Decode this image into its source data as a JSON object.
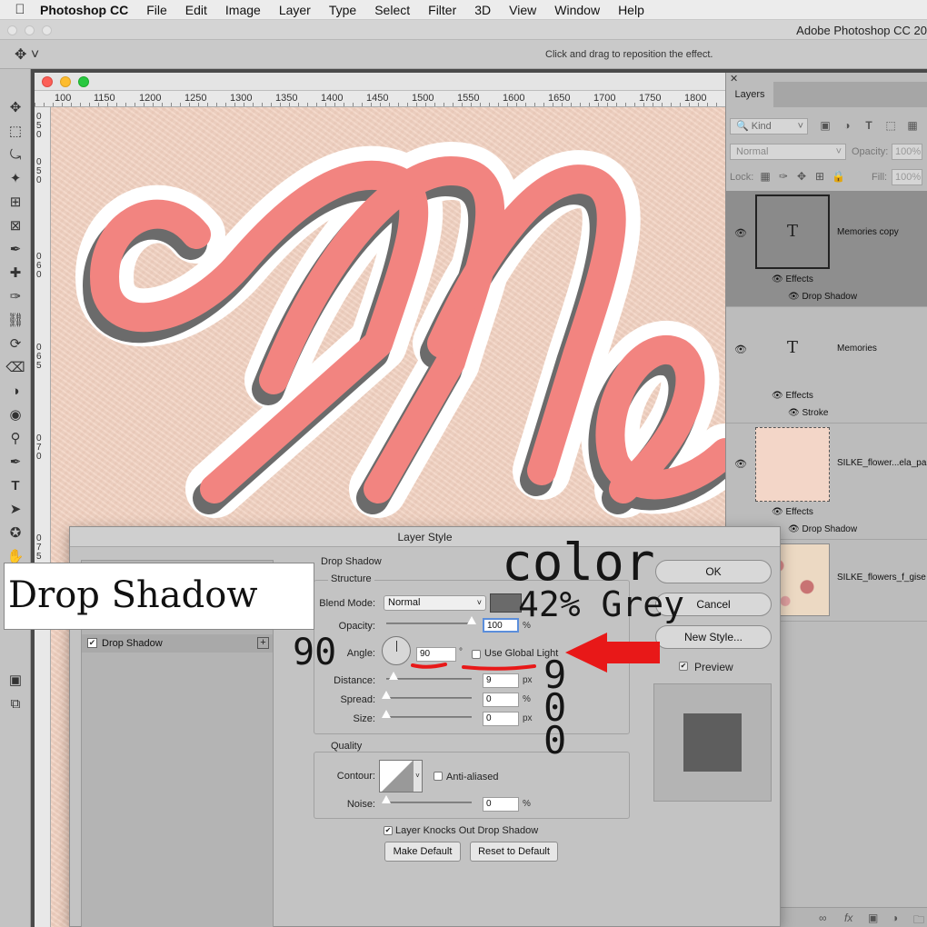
{
  "menubar": {
    "apple": "",
    "app": "Photoshop CC",
    "items": [
      "File",
      "Edit",
      "Image",
      "Layer",
      "Type",
      "Select",
      "Filter",
      "3D",
      "View",
      "Window",
      "Help"
    ]
  },
  "app_title": "Adobe Photoshop CC 20",
  "options_bar": {
    "hint": "Click and drag to reposition the effect."
  },
  "ruler": {
    "h_ticks": [
      "100",
      "1150",
      "1200",
      "1250",
      "1300",
      "1350",
      "1400",
      "1450",
      "1500",
      "1550",
      "1600",
      "1650",
      "1700",
      "1750",
      "1800"
    ],
    "v_ticks": [
      "0",
      "5",
      "0",
      "0",
      "5",
      "0",
      "0",
      "6",
      "0",
      "0",
      "6",
      "5",
      "0",
      "7",
      "0",
      "0",
      "7",
      "5",
      "0"
    ]
  },
  "artwork": {
    "letters": "Me",
    "fill_color": "#f28480",
    "shadow_color": "#6b6b6b",
    "outline_color": "#ffffff"
  },
  "layers_panel": {
    "tab": "Layers",
    "filter_kind": "Kind",
    "blend_mode": "Normal",
    "opacity_label": "Opacity:",
    "opacity_value": "100%",
    "lock_label": "Lock:",
    "fill_label": "Fill:",
    "fill_value": "100%",
    "layers": [
      {
        "name": "Memories copy",
        "thumb": "T",
        "effects_label": "Effects",
        "effect": "Drop Shadow",
        "selected": true
      },
      {
        "name": "Memories",
        "thumb": "T",
        "effects_label": "Effects",
        "effect": "Stroke",
        "selected": false
      },
      {
        "name": "SILKE_flower...ela_pa",
        "effects_label": "Effects",
        "effect": "Drop Shadow",
        "selected": false
      },
      {
        "name": "SILKE_flowers_f_gise",
        "selected": false
      }
    ]
  },
  "dialog": {
    "title": "Layer Style",
    "styles_list": {
      "item": "Drop Shadow",
      "checked": true
    },
    "section_title": "Drop Shadow",
    "structure_label": "Structure",
    "blend_mode_label": "Blend Mode:",
    "blend_mode_value": "Normal",
    "shadow_color": "#6a6a6a",
    "opacity_label": "Opacity:",
    "opacity_value": "100",
    "opacity_pct": 100,
    "angle_label": "Angle:",
    "angle_value": "90",
    "degree_symbol": "°",
    "global_light_label": "Use Global Light",
    "distance_label": "Distance:",
    "distance_value": "9",
    "distance_pct": 9,
    "spread_label": "Spread:",
    "spread_value": "0",
    "spread_pct": 0,
    "size_label": "Size:",
    "size_value": "0",
    "size_pct": 0,
    "unit_px": "px",
    "unit_pct": "%",
    "quality_label": "Quality",
    "contour_label": "Contour:",
    "anti_aliased_label": "Anti-aliased",
    "noise_label": "Noise:",
    "noise_value": "0",
    "noise_pct": 0,
    "knockout_label": "Layer Knocks Out Drop Shadow",
    "make_default": "Make Default",
    "reset_default": "Reset to Default",
    "ok": "OK",
    "cancel": "Cancel",
    "new_style": "New Style...",
    "preview_label": "Preview"
  },
  "annotations": {
    "drop_shadow": "Drop Shadow",
    "color": "color",
    "color_value": "42% Grey",
    "angle": "90",
    "distance": "9",
    "spread": "0",
    "size": "0",
    "arrow_color": "#e81818",
    "underline_color": "#e81818"
  }
}
